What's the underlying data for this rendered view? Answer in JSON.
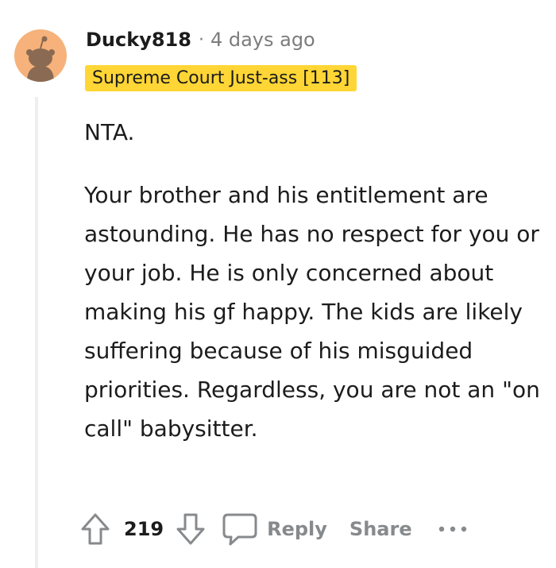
{
  "comment": {
    "author": "Ducky818",
    "separator": "·",
    "timestamp": "4 days ago",
    "flair": "Supreme Court Just-ass [113]",
    "paragraphs": [
      "NTA.",
      "Your brother and his entitlement are astounding. He has no respect for you or your job. He is only concerned about making his gf happy. The kids are likely suffering because of his misguided priorities. Regardless, you are not an \"on call\" babysitter."
    ]
  },
  "actions": {
    "upvote_icon": "upvote-arrow-icon",
    "vote_count": "219",
    "downvote_icon": "downvote-arrow-icon",
    "reply_icon": "speech-bubble-icon",
    "reply_label": "Reply",
    "share_label": "Share",
    "more_icon": "ellipsis-icon"
  },
  "colors": {
    "flair_bg": "#ffd635",
    "muted_text": "#7c7c7c",
    "action_text": "#878a8c",
    "avatar_bg": "#f6b27a",
    "thread_line": "#edeff1"
  }
}
